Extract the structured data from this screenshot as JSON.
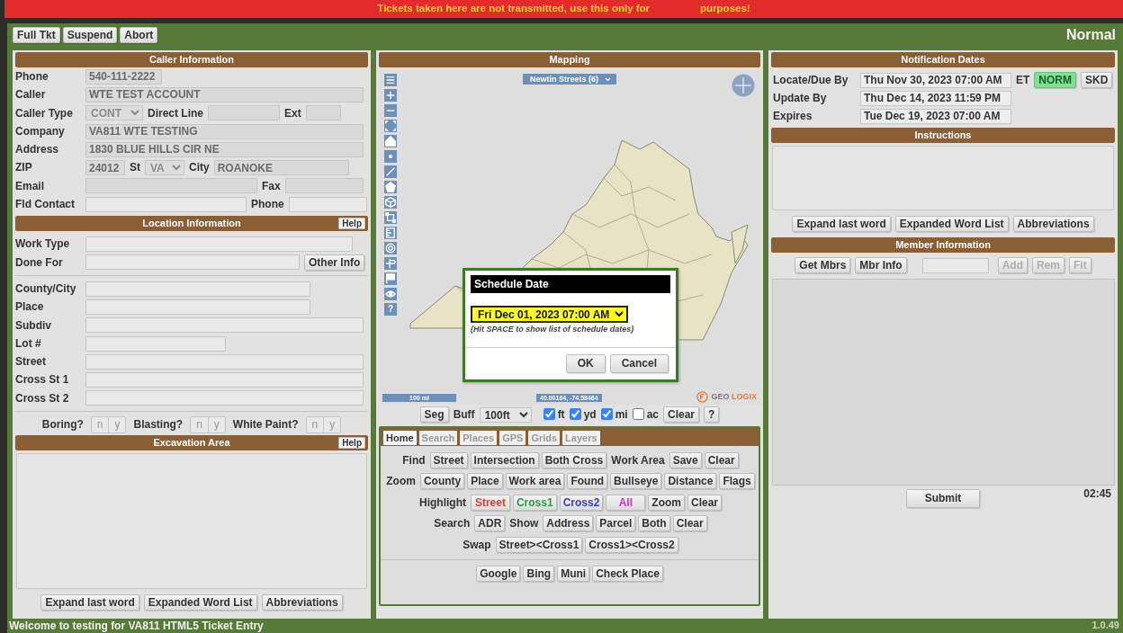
{
  "banner": {
    "texts": [
      "Tickets taken here are not transmitted, use this only for",
      "purposes!"
    ]
  },
  "toolbar": {
    "buttons": [
      "Full Tkt",
      "Suspend",
      "Abort"
    ],
    "mode": "Normal"
  },
  "caller_info": {
    "title": "Caller Information",
    "rows": [
      {
        "label": "Phone",
        "items": [
          {
            "kind": "input",
            "value": "540-111-2222",
            "disabled": true
          }
        ]
      },
      {
        "label": "Caller",
        "items": [
          {
            "kind": "input",
            "value": "WTE TEST ACCOUNT",
            "disabled": true
          }
        ]
      },
      {
        "label": "Caller Type",
        "items": [
          {
            "kind": "select",
            "value": "CONT",
            "disabled": true
          },
          {
            "kind": "label",
            "text": "Direct Line"
          },
          {
            "kind": "input",
            "disabled": true
          },
          {
            "kind": "label",
            "text": "Ext"
          },
          {
            "kind": "input",
            "disabled": true
          }
        ]
      },
      {
        "label": "Company",
        "items": [
          {
            "kind": "input",
            "value": "VA811 WTE TESTING",
            "disabled": true
          }
        ]
      },
      {
        "label": "Address",
        "items": [
          {
            "kind": "input",
            "value": "1830 BLUE HILLS CIR NE",
            "disabled": true
          }
        ]
      },
      {
        "label": "ZIP",
        "items": [
          {
            "kind": "input",
            "value": "24012",
            "disabled": true
          },
          {
            "kind": "label",
            "text": "St"
          },
          {
            "kind": "select",
            "value": "VA",
            "disabled": true
          },
          {
            "kind": "label",
            "text": "City"
          },
          {
            "kind": "input",
            "value": "ROANOKE",
            "disabled": true
          }
        ]
      },
      {
        "label": "Email",
        "items": [
          {
            "kind": "input",
            "disabled": true
          },
          {
            "kind": "label",
            "text": "Fax"
          },
          {
            "kind": "input",
            "disabled": true
          }
        ]
      },
      {
        "label": "Fld Contact",
        "items": [
          {
            "kind": "input",
            "disabled": false
          },
          {
            "kind": "label",
            "text": "Phone"
          },
          {
            "kind": "input",
            "disabled": false
          }
        ]
      }
    ]
  },
  "location_info": {
    "title": "Location Information",
    "help": "Help",
    "groups": [
      [
        {
          "label": "Work Type",
          "items": [
            {
              "kind": "input",
              "disabled": false
            }
          ]
        },
        {
          "label": "Done For",
          "items": [
            {
              "kind": "input",
              "disabled": false
            },
            {
              "kind": "button",
              "text": "Other Info"
            }
          ]
        }
      ],
      [
        {
          "label": "County/City",
          "items": [
            {
              "kind": "input",
              "disabled": false
            }
          ]
        },
        {
          "label": "Place",
          "items": [
            {
              "kind": "input",
              "disabled": false
            }
          ]
        },
        {
          "label": "Subdiv",
          "items": [
            {
              "kind": "input",
              "disabled": false
            }
          ]
        },
        {
          "label": "Lot #",
          "items": [
            {
              "kind": "input",
              "disabled": false
            }
          ]
        },
        {
          "label": "Street",
          "items": [
            {
              "kind": "input",
              "disabled": false
            }
          ]
        },
        {
          "label": "Cross St 1",
          "items": [
            {
              "kind": "input",
              "disabled": false
            }
          ]
        },
        {
          "label": "Cross St 2",
          "items": [
            {
              "kind": "input",
              "disabled": false
            }
          ]
        }
      ]
    ],
    "flags": [
      {
        "label": "Boring?",
        "options": [
          {
            "label": "n",
            "selected": false
          },
          {
            "label": "y",
            "selected": false
          }
        ]
      },
      {
        "label": "Blasting?",
        "options": [
          {
            "label": "n",
            "selected": false
          },
          {
            "label": "y",
            "selected": false
          }
        ]
      },
      {
        "label": "White Paint?",
        "options": [
          {
            "label": "n",
            "selected": false
          },
          {
            "label": "y",
            "selected": false
          }
        ]
      }
    ]
  },
  "excavation": {
    "title": "Excavation Area",
    "help": "Help",
    "buttons": [
      "Expand last word",
      "Expanded Word List",
      "Abbreviations"
    ]
  },
  "mapping": {
    "title": "Mapping",
    "layer": "Newtin Streets (6)",
    "tools": [
      {
        "kind": "menu"
      },
      {
        "kind": "plus"
      },
      {
        "kind": "minus"
      },
      {
        "kind": "frame"
      },
      {
        "kind": "home"
      },
      {
        "kind": "dot"
      },
      {
        "kind": "line"
      },
      {
        "kind": "pentagon"
      },
      {
        "kind": "cube"
      },
      {
        "kind": "selection"
      },
      {
        "kind": "ruler"
      },
      {
        "kind": "target"
      },
      {
        "kind": "signpost"
      },
      {
        "kind": "flag"
      },
      {
        "kind": "eye"
      },
      {
        "kind": "help",
        "label": "?"
      }
    ],
    "scale": "100 mi",
    "coords": "40.00164, -74.58464",
    "logo": [
      "GEO",
      "LOGIX"
    ],
    "controls": [
      {
        "kind": "button",
        "text": "Seg"
      },
      {
        "kind": "label",
        "text": "Buff"
      },
      {
        "kind": "select",
        "value": "100ft"
      },
      {
        "kind": "check",
        "text": "ft",
        "checked": true
      },
      {
        "kind": "check",
        "text": "yd",
        "checked": true
      },
      {
        "kind": "check",
        "text": "mi",
        "checked": true
      },
      {
        "kind": "check",
        "text": "ac",
        "checked": false
      },
      {
        "kind": "button",
        "text": "Clear"
      },
      {
        "kind": "button",
        "text": "?"
      }
    ]
  },
  "dialog": {
    "title": "Schedule Date",
    "value": "Fri Dec 01, 2023 07:00 AM",
    "hint": "(Hit SPACE to show list of schedule dates)",
    "buttons": [
      "OK",
      "Cancel"
    ]
  },
  "tabs": [
    {
      "label": "Home",
      "selected": true
    },
    {
      "label": "Search",
      "selected": false
    },
    {
      "label": "Places",
      "selected": false
    },
    {
      "label": "GPS",
      "selected": false
    },
    {
      "label": "Grids",
      "selected": false
    },
    {
      "label": "Layers",
      "selected": false
    }
  ],
  "tool_rows": [
    [
      {
        "kind": "label",
        "text": "Find"
      },
      {
        "kind": "button",
        "text": "Street"
      },
      {
        "kind": "button",
        "text": "Intersection"
      },
      {
        "kind": "button",
        "text": "Both Cross"
      },
      {
        "kind": "label",
        "text": "Work Area"
      },
      {
        "kind": "button",
        "text": "Save"
      },
      {
        "kind": "button",
        "text": "Clear"
      }
    ],
    [
      {
        "kind": "label",
        "text": "Zoom"
      },
      {
        "kind": "button",
        "text": "County"
      },
      {
        "kind": "button",
        "text": "Place"
      },
      {
        "kind": "button",
        "text": "Work area"
      },
      {
        "kind": "button",
        "text": "Found"
      },
      {
        "kind": "button",
        "text": "Bullseye"
      },
      {
        "kind": "button",
        "text": "Distance"
      },
      {
        "kind": "button",
        "text": "Flags"
      }
    ],
    [
      {
        "kind": "label",
        "text": "Highlight"
      },
      {
        "kind": "button",
        "text": "Street",
        "color": "#e03a3a"
      },
      {
        "kind": "button",
        "text": "Cross1",
        "color": "#2e9a48"
      },
      {
        "kind": "button",
        "text": "Cross2",
        "color": "#3a3ad8"
      },
      {
        "kind": "button",
        "text": "All",
        "color": "#e028e0"
      },
      {
        "kind": "button",
        "text": "Zoom"
      },
      {
        "kind": "button",
        "text": "Clear"
      }
    ],
    [
      {
        "kind": "label",
        "text": "Search"
      },
      {
        "kind": "button",
        "text": "ADR"
      },
      {
        "kind": "label",
        "text": "Show"
      },
      {
        "kind": "button",
        "text": "Address"
      },
      {
        "kind": "button",
        "text": "Parcel"
      },
      {
        "kind": "button",
        "text": "Both"
      },
      {
        "kind": "button",
        "text": "Clear"
      }
    ],
    [
      {
        "kind": "label",
        "text": "Swap"
      },
      {
        "kind": "button",
        "text": "Street><Cross1"
      },
      {
        "kind": "button",
        "text": "Cross1><Cross2"
      }
    ]
  ],
  "links": [
    "Google",
    "Bing",
    "Muni",
    "Check Place"
  ],
  "notification": {
    "title": "Notification Dates",
    "rows": [
      {
        "label": "Locate/Due By",
        "value": "Thu Nov 30, 2023 07:00 AM"
      },
      {
        "label": "Update By",
        "value": "Thu Dec 14, 2023 11:59 PM"
      },
      {
        "label": "Expires",
        "value": "Tue Dec 19, 2023 07:00 AM"
      }
    ],
    "zone": "ET",
    "modes": [
      {
        "label": "NORM",
        "selected": true
      },
      {
        "label": "SKD",
        "selected": false
      }
    ]
  },
  "instructions": {
    "title": "Instructions",
    "buttons": [
      "Expand last word",
      "Expanded Word List",
      "Abbreviations"
    ]
  },
  "members": {
    "title": "Member Information",
    "actions": [
      {
        "kind": "button",
        "label": "Get Mbrs",
        "disabled": false
      },
      {
        "kind": "button",
        "label": "Mbr Info",
        "disabled": false
      },
      {
        "kind": "input"
      },
      {
        "kind": "button",
        "label": "Add",
        "disabled": true
      },
      {
        "kind": "button",
        "label": "Rem",
        "disabled": true
      },
      {
        "kind": "button",
        "label": "Fit",
        "disabled": true
      }
    ],
    "submit": "Submit",
    "timer": "02:45"
  },
  "status_bar": {
    "text": "Welcome to testing for VA811 HTML5 Ticket Entry",
    "version": "1.0.49"
  }
}
